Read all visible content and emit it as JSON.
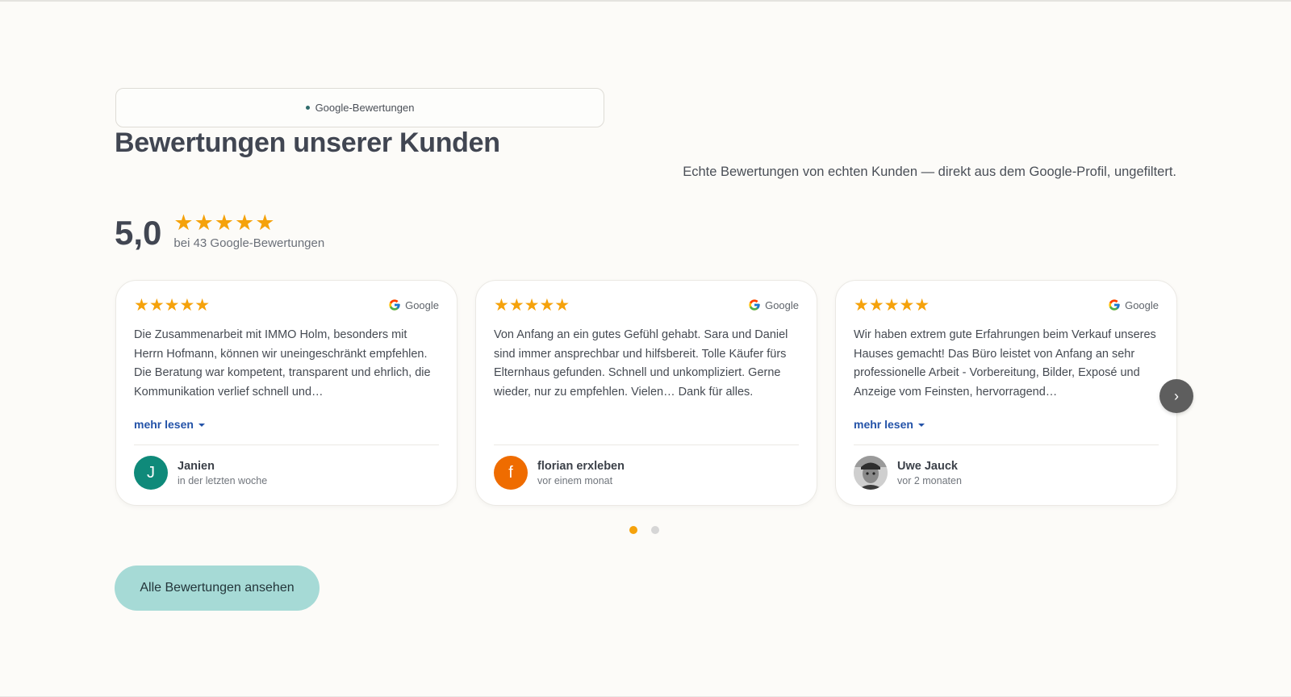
{
  "section": {
    "eyebrow": "Google-Bewertungen",
    "headline": "Bewertungen unserer Kunden",
    "subline": "Echte Bewertungen von echten Kunden — direkt aus dem Google-Profil, ungefiltert."
  },
  "summary": {
    "score": "5,0",
    "stars": "★★★★★",
    "count_label": "bei 43 Google-Bewertungen"
  },
  "reviews": [
    {
      "stars": "★★★★★",
      "source": "Google",
      "text": "Die Zusammenarbeit mit IMMO Holm, besonders mit Herrn Hofmann, können wir uneingeschränkt empfehlen. Die Beratung war kompetent, transparent und ehrlich, die Kommunikation verlief schnell und…",
      "more_label": "mehr lesen",
      "author_initial": "J",
      "author_name": "Janien",
      "time": "in der letzten woche",
      "avatar_color": "#0f8a7a"
    },
    {
      "stars": "★★★★★",
      "source": "Google",
      "text": "Von Anfang an ein gutes Gefühl gehabt. Sara und Daniel sind immer ansprechbar und hilfsbereit. Tolle Käufer fürs Elternhaus gefunden. Schnell und unkompliziert. Gerne wieder, nur zu empfehlen. Vielen… Dank für alles.",
      "author_initial": "f",
      "author_name": "florian erxleben",
      "time": "vor einem monat",
      "avatar_color": "#ef6c00"
    },
    {
      "stars": "★★★★★",
      "source": "Google",
      "text": "Wir haben extrem gute Erfahrungen beim Verkauf unseres Hauses gemacht! Das Büro leistet von Anfang an sehr professionelle Arbeit - Vorbereitung, Bilder, Exposé und Anzeige vom Feinsten, hervorragend…",
      "more_label": "mehr lesen",
      "author_name": "Uwe Jauck",
      "time": "vor 2 monaten"
    }
  ],
  "carousel": {
    "next_icon": "›",
    "pages": 2,
    "active_page": 1
  },
  "cta": {
    "label": "Alle Bewertungen ansehen"
  },
  "colors": {
    "background": "#fcfbf8",
    "star": "#f5a20b",
    "link": "#2453a8",
    "cta": "#a6dad6"
  }
}
